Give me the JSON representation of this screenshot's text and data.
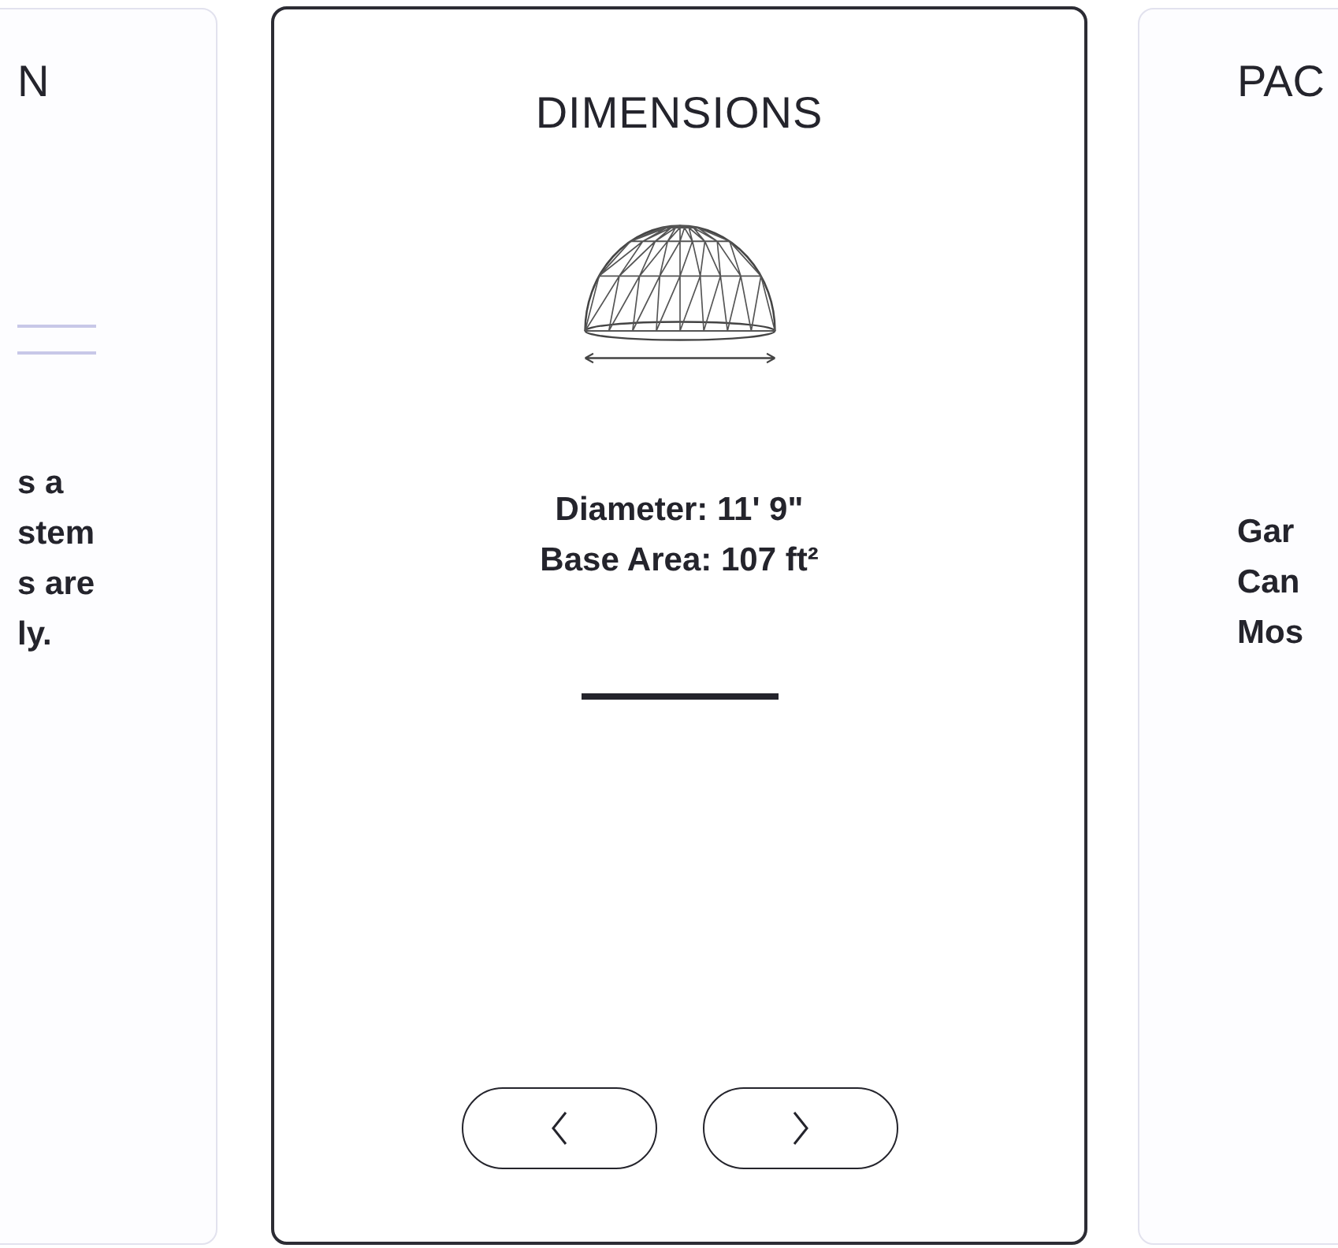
{
  "cards": [
    {
      "kind": "side-left",
      "title": "N",
      "lines": [
        "s a",
        "stem",
        "s are",
        "ly."
      ]
    },
    {
      "kind": "main",
      "title": "DIMENSIONS",
      "lines": [
        "Diameter: 11' 9\"",
        "Base Area: 107 ft²"
      ]
    },
    {
      "kind": "side-right",
      "title": "PAC",
      "lines": [
        "Gar",
        "Can",
        "Mos"
      ]
    }
  ]
}
